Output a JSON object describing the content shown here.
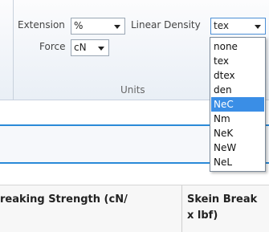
{
  "units": {
    "group_caption": "Units",
    "extension": {
      "label": "Extension",
      "value": "%"
    },
    "force": {
      "label": "Force",
      "value": "cN"
    },
    "linear_density": {
      "label": "Linear Density",
      "value": "tex",
      "options": [
        "none",
        "tex",
        "dtex",
        "den",
        "NeC",
        "Nm",
        "NeK",
        "NeW",
        "NeL"
      ],
      "highlighted_option": "NeC"
    }
  },
  "grid": {
    "columns": [
      {
        "label": "reaking Strength (cN/"
      },
      {
        "label_line1": "Skein Break",
        "label_line2": "x lbf)"
      }
    ]
  },
  "colors": {
    "accent": "#2a8ad8",
    "selection": "#3a8ee6"
  }
}
